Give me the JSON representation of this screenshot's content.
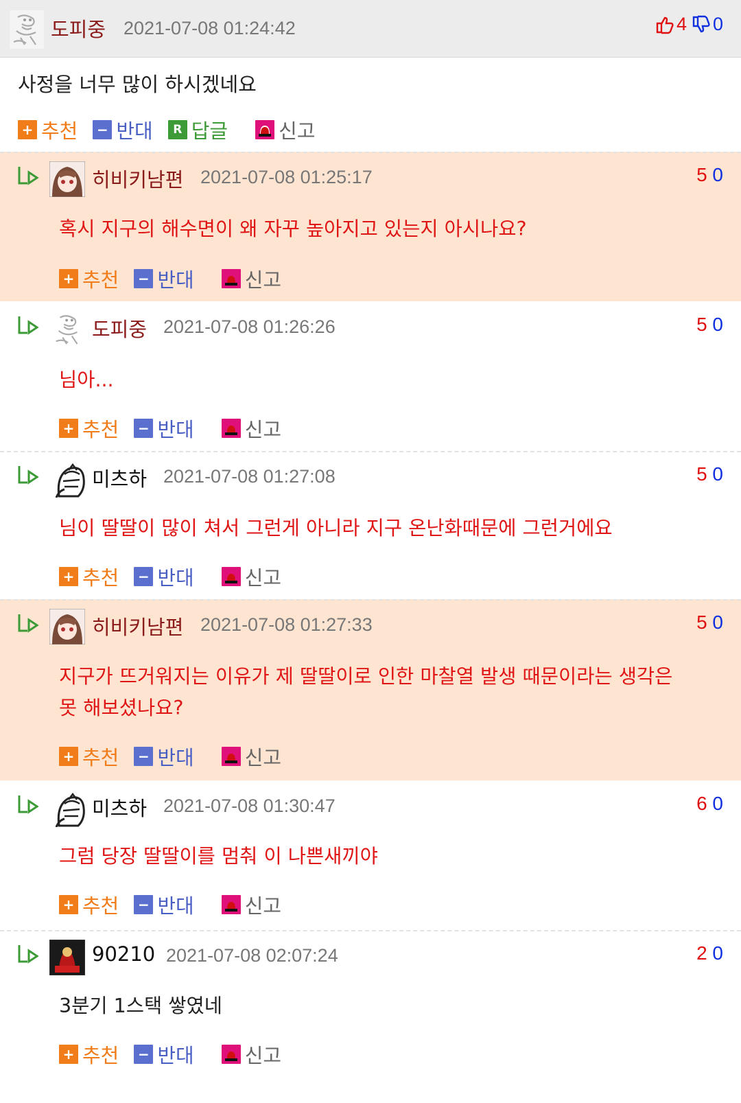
{
  "post": {
    "author": "도피중",
    "timestamp": "2021-07-08 01:24:42",
    "up": "4",
    "down": "0",
    "text": "사정을 너무 많이 하시겠네요",
    "actions": {
      "recommend": "추천",
      "oppose": "반대",
      "reply": "답글",
      "report": "신고"
    },
    "reply_icon_letter": "R"
  },
  "comments": [
    {
      "author": "히비키남편",
      "timestamp": "2021-07-08 01:25:17",
      "up": "5",
      "down": "0",
      "text": "혹시 지구의 해수면이 왜 자꾸 높아지고 있는지 아시나요?",
      "avatar": "anime-avatar"
    },
    {
      "author": "도피중",
      "timestamp": "2021-07-08 01:26:26",
      "up": "5",
      "down": "0",
      "text": "님아...",
      "avatar": "sketch-avatar"
    },
    {
      "author": "미츠하",
      "timestamp": "2021-07-08 01:27:08",
      "up": "5",
      "down": "0",
      "text": "님이 딸딸이 많이 쳐서 그런게 아니라 지구 온난화때문에 그런거에요",
      "avatar": "facepalm-avatar"
    },
    {
      "author": "히비키남편",
      "timestamp": "2021-07-08 01:27:33",
      "up": "5",
      "down": "0",
      "text_line1": "지구가 뜨거워지는 이유가 제 딸딸이로 인한 마찰열 발생 때문이라는 생각은",
      "text_line2": "못 해보셨나요?",
      "avatar": "anime-avatar"
    },
    {
      "author": "미츠하",
      "timestamp": "2021-07-08 01:30:47",
      "up": "6",
      "down": "0",
      "text": "그럼 당장 딸딸이를 멈춰 이 나쁜새끼야",
      "avatar": "facepalm-avatar"
    },
    {
      "author": "90210",
      "timestamp": "2021-07-08 02:07:24",
      "up": "2",
      "down": "0",
      "text": "3분기 1스택 쌓였네",
      "avatar": "dark-avatar"
    }
  ],
  "comment_actions": {
    "recommend": "추천",
    "oppose": "반대",
    "report": "신고"
  },
  "icon_glyphs": {
    "plus": "+",
    "minus": "−"
  },
  "colors": {
    "highlight_bg": "#fde5d2",
    "header_bg": "#ececec",
    "author": "#8b1a1a",
    "comment_text": "#e01616",
    "up": "#e01010",
    "down": "#1030e0",
    "recommend": "#f07c1a",
    "oppose": "#5b6fcf",
    "reply": "#3c9a37",
    "report": "#e0107a"
  }
}
